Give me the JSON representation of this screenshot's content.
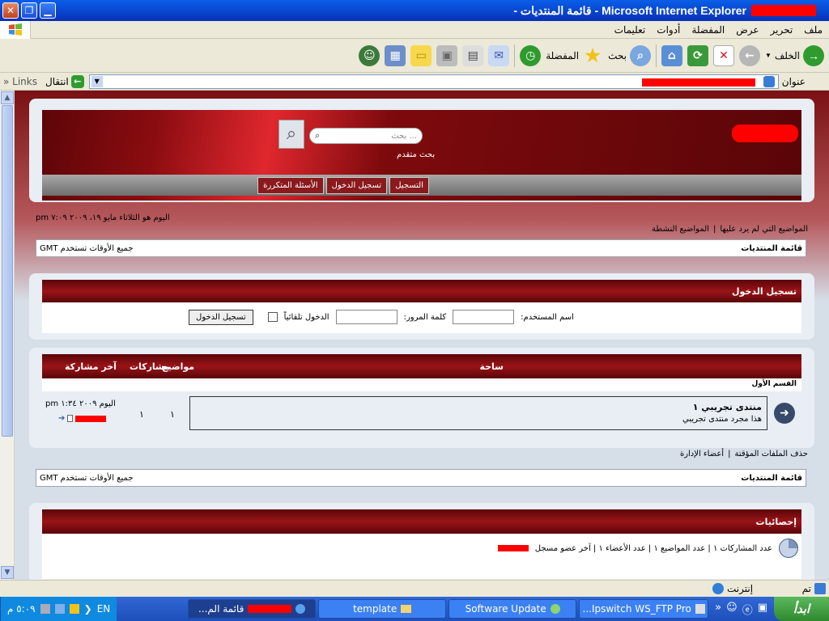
{
  "window": {
    "title": "Microsoft Internet Explorer - قائمة المنتديات -"
  },
  "menu": {
    "items": [
      "ملف",
      "تحرير",
      "عرض",
      "المفضلة",
      "أدوات",
      "تعليمات"
    ]
  },
  "toolbar": {
    "back_label": "الخلف",
    "search_label": "بحث",
    "favorites_label": "المفضلة"
  },
  "address": {
    "label": "عنوان",
    "go_label": "انتقال",
    "links_label": "Links"
  },
  "forum": {
    "search_placeholder": "بحث ...",
    "advanced_search": "بحث متقدم",
    "nav": {
      "register": "التسجيل",
      "login": "تسجيل الدخول",
      "faq": "الأسئلة المتكررة"
    },
    "date_text": "اليوم هو الثلاثاء مايو ١٩، ٢٠٠٩ ٧:٠٩ pm",
    "links": {
      "unanswered": "المواضيع التي لم يرد عليها",
      "active": "المواضيع النشطة"
    },
    "breadcrumb": "قائمة المنتديات",
    "timezone": "جميع الأوقات تستخدم GMT",
    "login_box": {
      "title": "تسجيل الدخول",
      "username_label": "اسم المستخدم:",
      "password_label": "كلمة المرور:",
      "auto_login_label": "الدخول تلقائياً",
      "submit_label": "تسجيل الدخول"
    },
    "table": {
      "headers": {
        "forum": "ساحة",
        "topics": "مواضيع",
        "posts": "مشاركات",
        "last_post": "آخر مشاركة"
      },
      "category": "القسم الأول",
      "row": {
        "title": "منتدى تجريبي ١",
        "description": "هذا مجرد منتدى تجريبي",
        "topics": "١",
        "posts": "١",
        "last_post_time": "اليوم ٢٠٠٩ ١:٣٤ pm"
      }
    },
    "footer_links": {
      "delete_cookies": "حذف الملفات المؤقتة",
      "team": "أعضاء الإدارة"
    },
    "stats": {
      "title": "إحصائيات",
      "text": "عدد المشاركات ١ | عدد المواضيع ١ | عدد الأعضاء ١ | آخر عضو مسجل"
    }
  },
  "statusbar": {
    "done": "تم",
    "zone": "إنترنت"
  },
  "taskbar": {
    "start": "ابدأ",
    "tasks": [
      "Ipswitch WS_FTP Pro...",
      "Software Update",
      "template",
      "قائمة الم..."
    ],
    "lang": "EN",
    "clock": "٥:٠٩ م"
  }
}
